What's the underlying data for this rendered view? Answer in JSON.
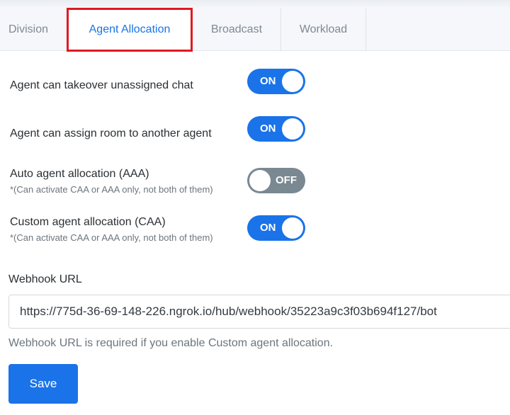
{
  "tabs": {
    "division": "Division",
    "agent_allocation": "Agent Allocation",
    "broadcast": "Broadcast",
    "workload": "Workload"
  },
  "settings": [
    {
      "label": "Agent can takeover unassigned chat",
      "note": "",
      "state": "ON"
    },
    {
      "label": "Agent can assign room to another agent",
      "note": "",
      "state": "ON"
    },
    {
      "label": "Auto agent allocation (AAA)",
      "note": "*(Can activate CAA or AAA only, not both of them)",
      "state": "OFF"
    },
    {
      "label": "Custom agent allocation (CAA)",
      "note": "*(Can activate CAA or AAA only, not both of them)",
      "state": "ON"
    }
  ],
  "webhook": {
    "label": "Webhook URL",
    "value": "https://775d-36-69-148-226.ngrok.io/hub/webhook/35223a9c3f03b694f127/bot",
    "help": "Webhook URL is required if you enable Custom agent allocation."
  },
  "save_label": "Save",
  "colors": {
    "accent": "#1a73e8",
    "toggle_off": "#7a8891",
    "active_tab_highlight": "#e0191f"
  }
}
